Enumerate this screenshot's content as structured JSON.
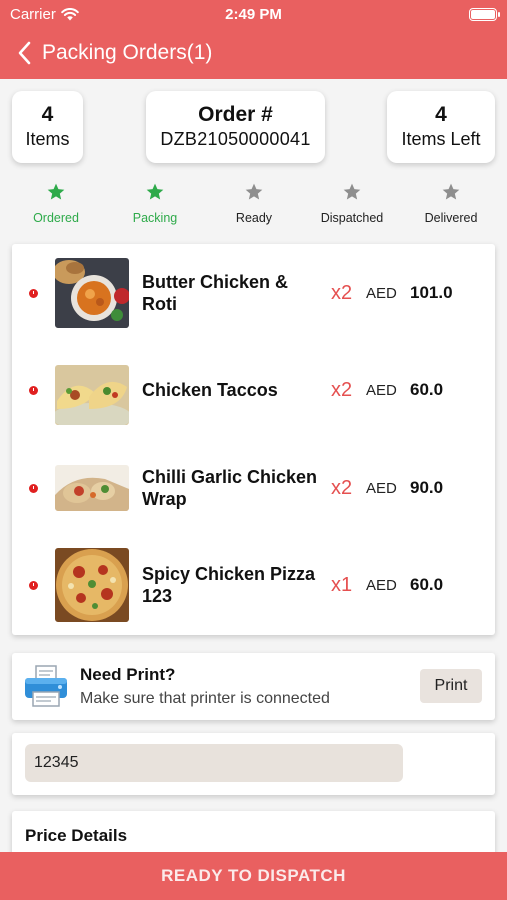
{
  "status_bar": {
    "carrier": "Carrier",
    "time": "2:49 PM"
  },
  "nav": {
    "title": "Packing Orders(1)"
  },
  "summary": {
    "items_count": "4",
    "items_label": "Items",
    "order_label": "Order #",
    "order_number": "DZB21050000041",
    "items_left_count": "4",
    "items_left_label": "Items Left"
  },
  "steps": [
    {
      "label": "Ordered",
      "active": true
    },
    {
      "label": "Packing",
      "active": true
    },
    {
      "label": "Ready",
      "active": false
    },
    {
      "label": "Dispatched",
      "active": false
    },
    {
      "label": "Delivered",
      "active": false
    }
  ],
  "colors": {
    "brand": "#e96060",
    "step_active": "#2eaa4a",
    "step_inactive": "#8e8e8e",
    "quantity": "#e55050"
  },
  "order_items": [
    {
      "name": "Butter Chicken & Roti",
      "quantity": "x2",
      "currency": "AED",
      "price": "101.0",
      "image_icon": "butter-chicken-thumb"
    },
    {
      "name": "Chicken Taccos",
      "quantity": "x2",
      "currency": "AED",
      "price": "60.0",
      "image_icon": "tacos-thumb"
    },
    {
      "name": "Chilli Garlic Chicken Wrap",
      "quantity": "x2",
      "currency": "AED",
      "price": "90.0",
      "image_icon": "wrap-thumb"
    },
    {
      "name": "Spicy Chicken Pizza 123",
      "quantity": "x1",
      "currency": "AED",
      "price": "60.0",
      "image_icon": "pizza-thumb"
    }
  ],
  "print": {
    "title": "Need Print?",
    "subtitle": "Make sure that printer is connected",
    "button_label": "Print",
    "icon": "printer-icon"
  },
  "code_input": {
    "value": "12345"
  },
  "price_details": {
    "title": "Price Details"
  },
  "footer": {
    "button_label": "READY TO DISPATCH"
  }
}
